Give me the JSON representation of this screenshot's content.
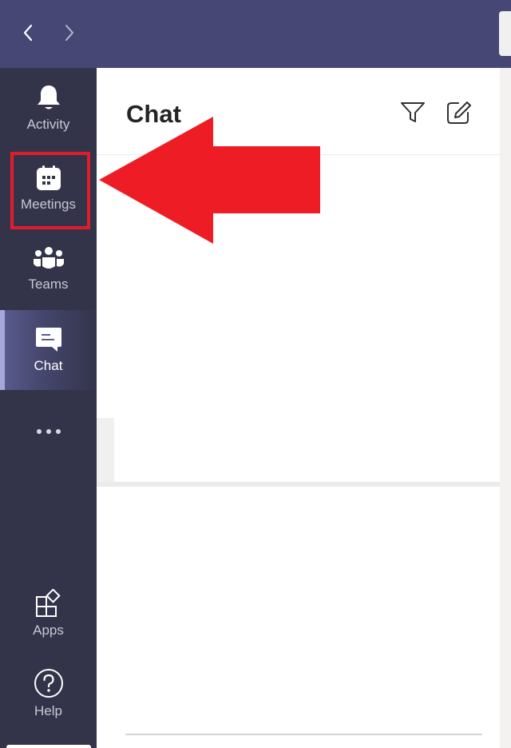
{
  "panel": {
    "title": "Chat"
  },
  "rail": {
    "items": [
      {
        "id": "activity",
        "label": "Activity",
        "icon": "bell-icon"
      },
      {
        "id": "meetings",
        "label": "Meetings",
        "icon": "calendar-icon"
      },
      {
        "id": "teams",
        "label": "Teams",
        "icon": "teams-icon"
      },
      {
        "id": "chat",
        "label": "Chat",
        "icon": "chat-icon",
        "active": true
      },
      {
        "id": "apps",
        "label": "Apps",
        "icon": "apps-icon"
      },
      {
        "id": "help",
        "label": "Help",
        "icon": "help-icon"
      }
    ]
  },
  "toolbar": {
    "back_icon": "chevron-left-icon",
    "forward_icon": "chevron-right-icon"
  },
  "colors": {
    "topbar": "#464775",
    "rail": "#33344a",
    "active_indicator": "#a6a7dc",
    "annotation_red": "#e11c2a"
  }
}
